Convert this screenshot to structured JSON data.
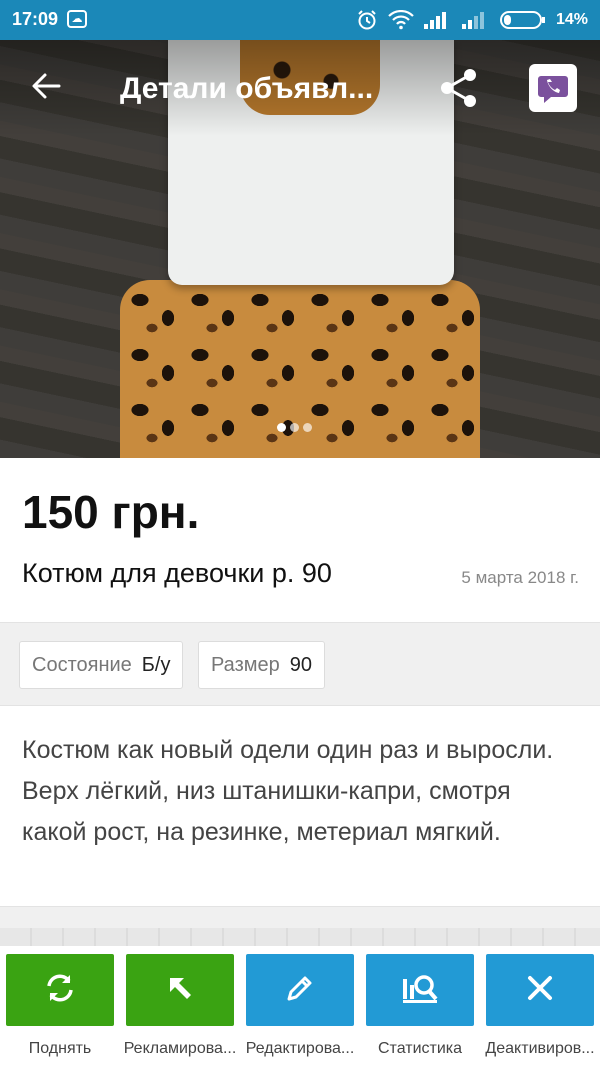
{
  "status_bar": {
    "time": "17:09",
    "battery_percent": "14%",
    "icons": [
      "cloud-icon",
      "alarm-icon",
      "wifi-icon",
      "signal-icon",
      "signal-icon",
      "battery-icon"
    ]
  },
  "app_bar": {
    "title": "Детали объявл...",
    "icons": [
      "back-arrow-icon",
      "share-icon",
      "viber-icon"
    ]
  },
  "gallery": {
    "dots_total": 3,
    "active_index": 0
  },
  "listing": {
    "price": "150 грн.",
    "title": "Котюм для девочки р. 90",
    "date": "5 марта 2018 г."
  },
  "params": [
    {
      "label": "Состояние",
      "value": "Б/у"
    },
    {
      "label": "Размер",
      "value": "90"
    }
  ],
  "description": "Костюм как новый одели один раз и выросли. Верх лёгкий, низ штанишки-капри, смотря какой рост, на резинке, метериал мягкий.",
  "actions": [
    {
      "label": "Поднять",
      "icon": "refresh-icon",
      "color": "#3aa312"
    },
    {
      "label": "Рекламирова...",
      "icon": "arrow-up-left-icon",
      "color": "#3aa312"
    },
    {
      "label": "Редактирова...",
      "icon": "pencil-icon",
      "color": "#229ad5"
    },
    {
      "label": "Статистика",
      "icon": "statistics-icon",
      "color": "#229ad5"
    },
    {
      "label": "Деактивиров...",
      "icon": "close-icon",
      "color": "#229ad5"
    }
  ],
  "colors": {
    "status_bar": "#1b88b8",
    "green": "#3aa312",
    "blue": "#229ad5"
  }
}
